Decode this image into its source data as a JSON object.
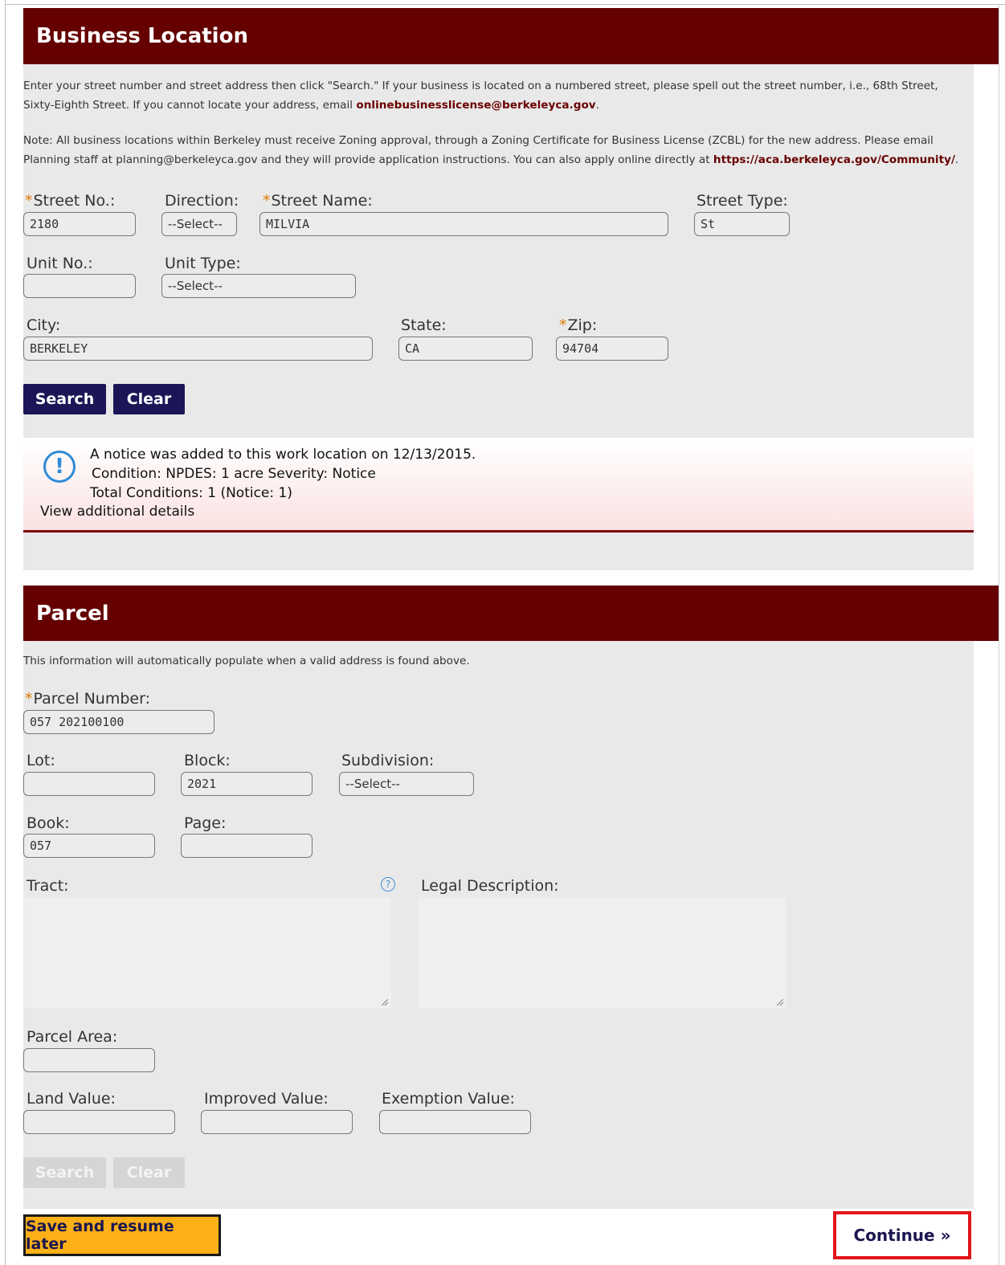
{
  "business_location": {
    "title": "Business Location",
    "intro_text": "Enter your street number and street address then click \"Search.\" If your business is located on a numbered street, please spell out the street number, i.e., 68th Street,",
    "intro_text_2": "Sixty-Eighth Street. If you cannot locate your address, email ",
    "intro_email": "onlinebusinesslicense@berkeleyca.gov",
    "intro_end": ".",
    "note_text": "Note: All business locations within Berkeley must receive Zoning approval, through a Zoning Certificate for Business License (ZCBL) for the new address. Please email",
    "note_text_2": "Planning staff at planning@berkeleyca.gov and they will provide application instructions. You can also apply online directly at ",
    "note_link": "https://aca.berkeleyca.gov/Community/",
    "note_end": ".",
    "required_mark": "*",
    "fields": {
      "street_no": {
        "label": "Street No.:",
        "value": "2180"
      },
      "direction": {
        "label": "Direction:",
        "value": "--Select--"
      },
      "street_name": {
        "label": "Street Name:",
        "value": "MILVIA"
      },
      "street_type": {
        "label": "Street Type:",
        "value": "St"
      },
      "unit_no": {
        "label": "Unit No.:",
        "value": ""
      },
      "unit_type": {
        "label": "Unit Type:",
        "value": "--Select--"
      },
      "city": {
        "label": "City:",
        "value": "BERKELEY"
      },
      "state": {
        "label": "State:",
        "value": "CA"
      },
      "zip": {
        "label": "Zip:",
        "value": "94704"
      }
    },
    "search_label": "Search",
    "clear_label": "Clear",
    "notice": {
      "line1": "A notice was added to this work location on 12/13/2015.",
      "line2": "Condition:  NPDES: 1 acre   Severity:  Notice",
      "line3": "Total Conditions: 1  (Notice: 1)",
      "details_link": "View additional details",
      "icon_glyph": "!"
    }
  },
  "parcel": {
    "title": "Parcel",
    "intro_text": "This information will automatically populate when a valid address is found above.",
    "fields": {
      "parcel_number": {
        "label": "Parcel Number:",
        "value": "057 202100100"
      },
      "lot": {
        "label": "Lot:",
        "value": ""
      },
      "block": {
        "label": "Block:",
        "value": "2021"
      },
      "subdivision": {
        "label": "Subdivision:",
        "value": "--Select--"
      },
      "book": {
        "label": "Book:",
        "value": "057"
      },
      "page": {
        "label": "Page:",
        "value": ""
      },
      "tract": {
        "label": "Tract:",
        "value": ""
      },
      "legal_description": {
        "label": "Legal Description:",
        "value": ""
      },
      "parcel_area": {
        "label": "Parcel Area:",
        "value": ""
      },
      "land_value": {
        "label": "Land Value:",
        "value": ""
      },
      "improved_value": {
        "label": "Improved Value:",
        "value": ""
      },
      "exemption_value": {
        "label": "Exemption Value:",
        "value": ""
      }
    },
    "help_glyph": "?",
    "search_label": "Search",
    "clear_label": "Clear"
  },
  "footer": {
    "save_label": "Save and resume later",
    "continue_label": "Continue »"
  },
  "colors": {
    "header": "#650000",
    "primary_button": "#1c1556",
    "save_button": "#fcb017",
    "continue_highlight": "#e0141a"
  }
}
